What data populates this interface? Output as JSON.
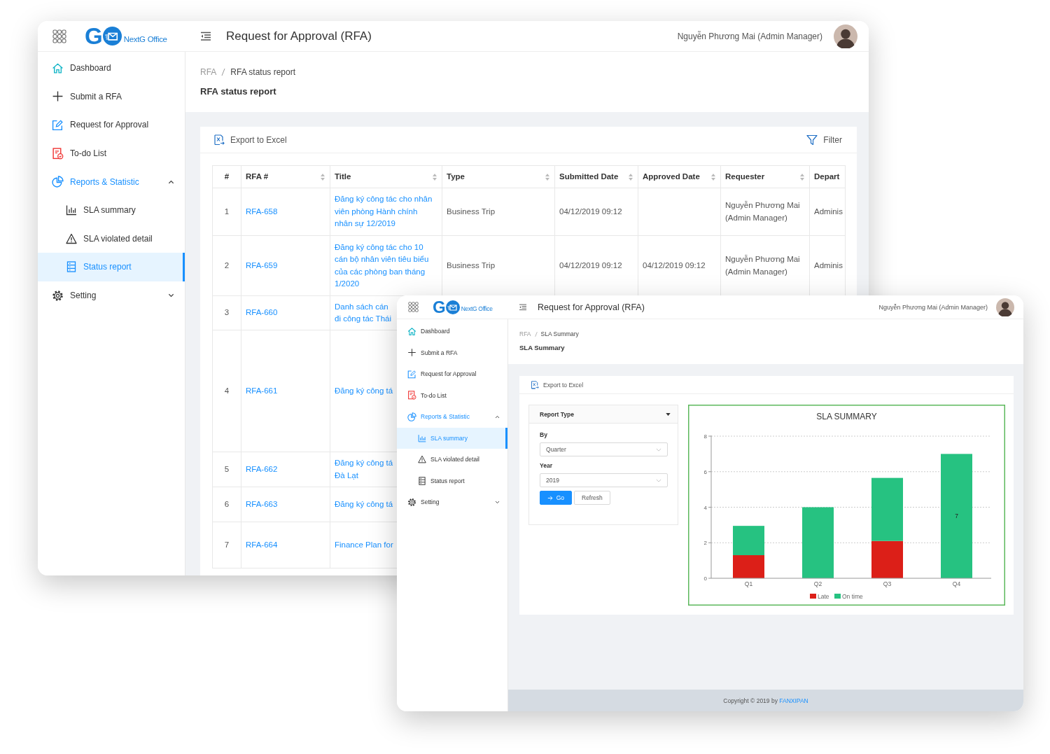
{
  "status_report_window": {
    "header": {
      "logo": {
        "mark": "G",
        "name": "NextG Office"
      },
      "title": "Request for Approval (RFA)",
      "user": "Nguyễn Phương Mai (Admin Manager)"
    },
    "sidebar": {
      "items": [
        {
          "label": "Dashboard",
          "selected": false
        },
        {
          "label": "Submit a RFA",
          "selected": false
        },
        {
          "label": "Request for Approval",
          "selected": false
        },
        {
          "label": "To-do List",
          "selected": false
        },
        {
          "label": "Reports & Statistic",
          "selected": false,
          "expanded": true,
          "children": [
            {
              "label": "SLA summary",
              "selected": false
            },
            {
              "label": "SLA violated detail",
              "selected": false
            },
            {
              "label": "Status report",
              "selected": true
            }
          ]
        },
        {
          "label": "Setting",
          "selected": false,
          "expanded": false
        }
      ]
    },
    "breadcrumb": [
      "RFA",
      "RFA status report"
    ],
    "page_title": "RFA status report",
    "toolbar": {
      "export": "Export to Excel",
      "filter": "Filter"
    },
    "table": {
      "columns": [
        {
          "label": "#",
          "sortable": false,
          "kind": "number"
        },
        {
          "label": "RFA #",
          "sortable": true,
          "kind": "link"
        },
        {
          "label": "Title",
          "sortable": true,
          "kind": "link"
        },
        {
          "label": "Type",
          "sortable": true,
          "kind": "text"
        },
        {
          "label": "Submitted Date",
          "sortable": true,
          "kind": "text"
        },
        {
          "label": "Approved Date",
          "sortable": true,
          "kind": "text"
        },
        {
          "label": "Requester",
          "sortable": true,
          "kind": "text"
        },
        {
          "label": "Depart",
          "sortable": false,
          "kind": "text"
        }
      ],
      "rows": [
        [
          "1",
          "RFA-658",
          "Đăng ký công tác cho nhân viên phòng Hành chính nhân sự 12/2019",
          "Business Trip",
          "04/12/2019 09:12",
          "",
          "Nguyễn Phương Mai (Admin Manager)",
          "Adminis"
        ],
        [
          "2",
          "RFA-659",
          "Đăng ký công tác cho 10 cán bộ nhân viên tiêu biểu của các phòng ban tháng 1/2020",
          "Business Trip",
          "04/12/2019 09:12",
          "04/12/2019 09:12",
          "Nguyễn Phương Mai (Admin Manager)",
          "Adminis"
        ],
        [
          "3",
          "RFA-660",
          "Danh sách cán\nđi công tác Thái"
        ],
        [
          "4",
          "RFA-661",
          "Đăng ký công tá"
        ],
        [
          "5",
          "RFA-662",
          "Đăng ký công tá\nĐà Lạt"
        ],
        [
          "6",
          "RFA-663",
          "Đăng ký công tá"
        ],
        [
          "7",
          "RFA-664",
          "Finance Plan for"
        ]
      ]
    }
  },
  "sla_summary_window": {
    "header": {
      "logo": {
        "mark": "G",
        "name": "NextG Office"
      },
      "title": "Request for Approval (RFA)",
      "user": "Nguyễn Phương Mai (Admin Manager)"
    },
    "sidebar": {
      "items": [
        {
          "label": "Dashboard",
          "selected": false
        },
        {
          "label": "Submit a RFA",
          "selected": false
        },
        {
          "label": "Request for Approval",
          "selected": false
        },
        {
          "label": "To-do List",
          "selected": false
        },
        {
          "label": "Reports & Statistic",
          "selected": false,
          "expanded": true,
          "children": [
            {
              "label": "SLA summary",
              "selected": true
            },
            {
              "label": "SLA violated detail",
              "selected": false
            },
            {
              "label": "Status report",
              "selected": false
            }
          ]
        },
        {
          "label": "Setting",
          "selected": false,
          "expanded": false
        }
      ]
    },
    "breadcrumb": [
      "RFA",
      "SLA Summary"
    ],
    "page_title": "SLA Summary",
    "toolbar": {
      "export": "Export to Excel"
    },
    "report_form": {
      "title": "Report Type",
      "fields": [
        {
          "label": "By",
          "value": "Quarter"
        },
        {
          "label": "Year",
          "value": "2019"
        }
      ],
      "buttons": [
        {
          "label": "Go",
          "primary": true
        },
        {
          "label": "Refresh",
          "primary": false
        }
      ]
    },
    "chart": {
      "chart_data": {
        "type": "bar",
        "title": "SLA SUMMARY",
        "categories": [
          "Q1",
          "Q2",
          "Q3",
          "Q4"
        ],
        "series": [
          {
            "name": "Late",
            "color": "#dc1f18",
            "values": [
              1.3,
              0,
              2.1,
              0
            ]
          },
          {
            "name": "On time",
            "color": "#26c281",
            "values": [
              1.65,
              4,
              3.55,
              7
            ]
          }
        ],
        "ylim": [
          0,
          8
        ],
        "yticks": [
          0,
          2,
          4,
          6,
          8
        ],
        "stacked": true,
        "grid": true,
        "legend": true,
        "annotations": [
          "7"
        ]
      }
    },
    "footer": {
      "text": "Copyright © 2019 by",
      "link": "FANXIPAN"
    }
  }
}
